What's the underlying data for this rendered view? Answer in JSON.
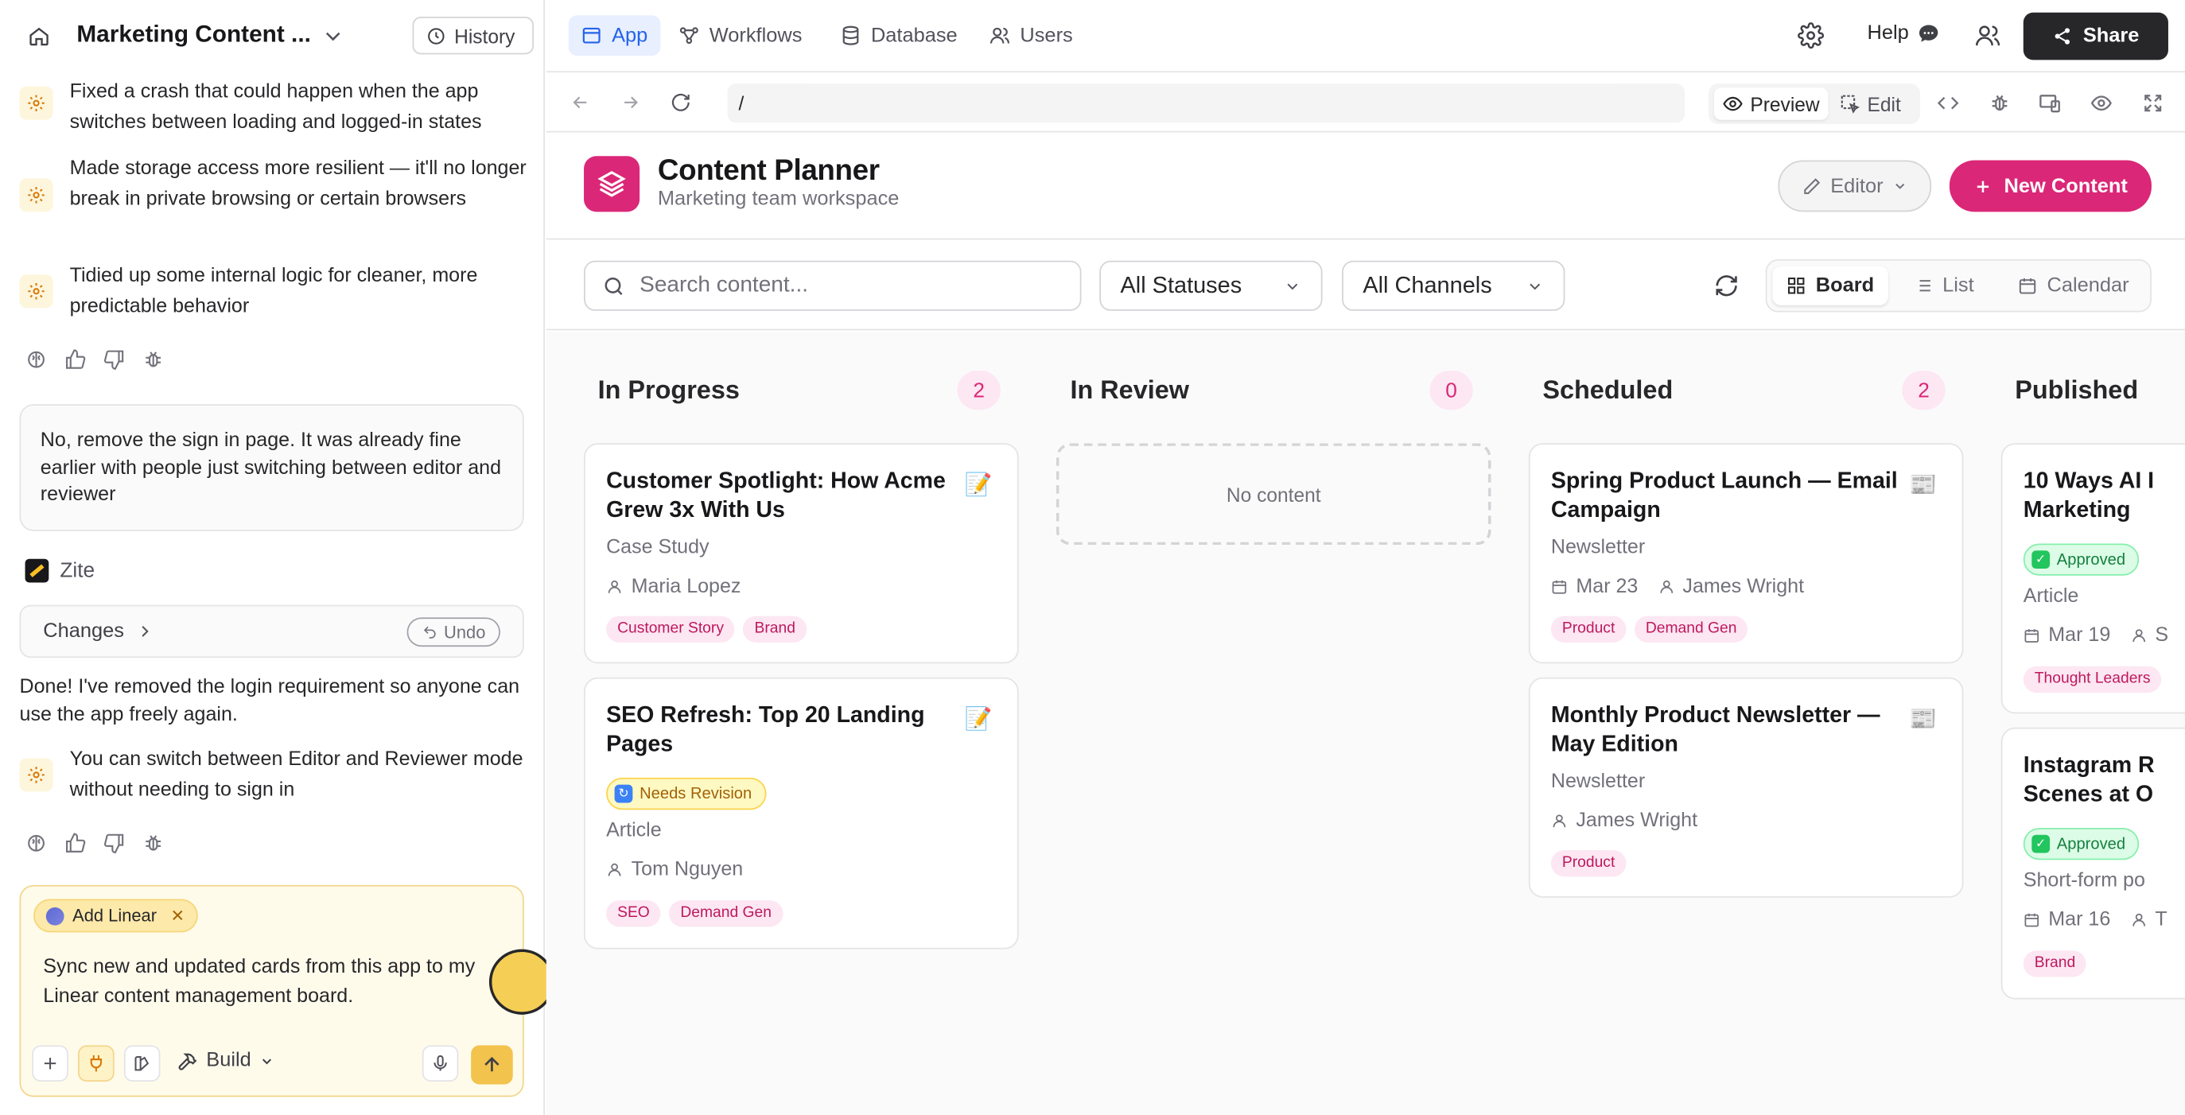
{
  "sidebar": {
    "project_title": "Marketing Content ...",
    "history_label": "History",
    "messages": [
      "Fixed a crash that could happen when the app switches between loading and logged-in states",
      "Made storage access more resilient — it'll no longer break in private browsing or certain browsers",
      "Tidied up some internal logic for cleaner, more predictable behavior"
    ],
    "user_message": "No, remove the sign in page. It was already fine earlier with people just switching between editor and reviewer",
    "assistant_name": "Zite",
    "changes_label": "Changes",
    "undo_label": "Undo",
    "done_text": "Done! I've removed the login requirement so anyone can use the app freely again.",
    "switch_text": "You can switch between Editor and Reviewer mode without needing to sign in",
    "composer": {
      "chip_label": "Add Linear",
      "text": "Sync new and updated cards from this app to my Linear content management board.",
      "mode_label": "Build"
    }
  },
  "topnav": {
    "tabs": [
      {
        "label": "App",
        "icon": "app-window-icon"
      },
      {
        "label": "Workflows",
        "icon": "workflow-icon"
      },
      {
        "label": "Database",
        "icon": "database-icon"
      },
      {
        "label": "Users",
        "icon": "users-icon"
      }
    ],
    "help_label": "Help",
    "share_label": "Share"
  },
  "browser": {
    "url": "/",
    "preview_label": "Preview",
    "edit_label": "Edit"
  },
  "app": {
    "title": "Content Planner",
    "subtitle": "Marketing team workspace",
    "editor_label": "Editor",
    "new_content_label": "New Content",
    "search_placeholder": "Search content...",
    "status_filter": "All Statuses",
    "channel_filter": "All Channels",
    "views": [
      "Board",
      "List",
      "Calendar"
    ],
    "active_view": "Board"
  },
  "board": {
    "empty_label": "No content",
    "columns": [
      {
        "title": "In Progress",
        "count": "2",
        "cards": [
          {
            "title": "Customer Spotlight: How Acme Grew 3x With Us",
            "type": "Case Study",
            "assignee": "Maria Lopez",
            "tags": [
              "Customer Story",
              "Brand"
            ]
          },
          {
            "title": "SEO Refresh: Top 20 Landing Pages",
            "status": "Needs Revision",
            "type": "Article",
            "assignee": "Tom Nguyen",
            "tags": [
              "SEO",
              "Demand Gen"
            ]
          }
        ]
      },
      {
        "title": "In Review",
        "count": "0",
        "cards": []
      },
      {
        "title": "Scheduled",
        "count": "2",
        "cards": [
          {
            "title": "Spring Product Launch — Email Campaign",
            "type": "Newsletter",
            "date": "Mar 23",
            "assignee": "James Wright",
            "tags": [
              "Product",
              "Demand Gen"
            ]
          },
          {
            "title": "Monthly Product Newsletter — May Edition",
            "type": "Newsletter",
            "assignee": "James Wright",
            "tags": [
              "Product"
            ]
          }
        ]
      },
      {
        "title": "Published",
        "cards": [
          {
            "title": "10 Ways AI I Marketing",
            "status": "Approved",
            "type": "Article",
            "date": "Mar 19",
            "assignee": "S",
            "tags": [
              "Thought Leaders"
            ]
          },
          {
            "title": "Instagram R Scenes at O",
            "status": "Approved",
            "type": "Short-form po",
            "date": "Mar 16",
            "assignee": "T",
            "tags": [
              "Brand"
            ]
          }
        ]
      }
    ]
  },
  "colors": {
    "accent": "#db2777",
    "nav_active": "#2563eb",
    "composer_bg": "#fffbeb"
  }
}
